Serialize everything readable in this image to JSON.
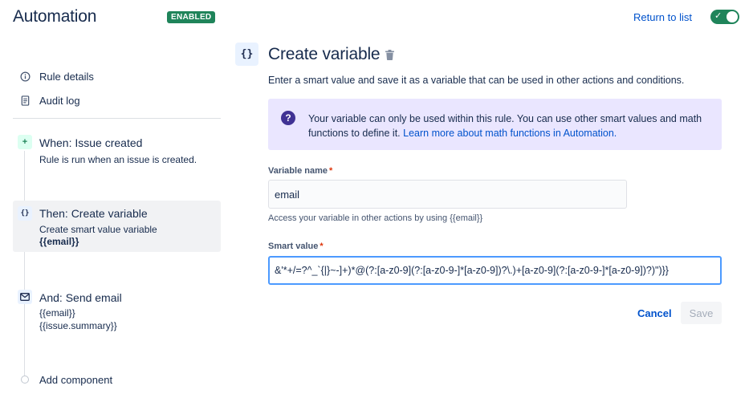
{
  "header": {
    "title": "Automation",
    "status": "ENABLED",
    "return_link": "Return to list",
    "toggle_on": true
  },
  "sidebar": {
    "rule_details": "Rule details",
    "audit_log": "Audit log",
    "components": [
      {
        "icon": "plus-icon",
        "title": "When: Issue created",
        "subtitle": "Rule is run when an issue is created."
      },
      {
        "icon": "braces-icon",
        "title": "Then: Create variable",
        "subtitle": "Create smart value variable",
        "subtitle_bold": "{{email}}",
        "selected": true
      },
      {
        "icon": "mail-icon",
        "title": "And: Send email",
        "line1": "{{email}}",
        "line2": "{{issue.summary}}"
      }
    ],
    "add_component": "Add component"
  },
  "main": {
    "icon_glyph": "{}",
    "title": "Create variable",
    "description": "Enter a smart value and save it as a variable that can be used in other actions and conditions.",
    "info": {
      "text": "Your variable can only be used within this rule. You can use other smart values and math functions to define it.",
      "link": "Learn more about math functions in Automation."
    },
    "variable_name": {
      "label": "Variable name",
      "value": "email",
      "help": "Access your variable in other actions by using {{email}}"
    },
    "smart_value": {
      "label": "Smart value",
      "value": "&'*+/=?^_`{|}~-]+)*@(?:[a-z0-9](?:[a-z0-9-]*[a-z0-9])?\\.)+[a-z0-9](?:[a-z0-9-]*[a-z0-9])?)\")}}"
    },
    "cancel_label": "Cancel",
    "save_label": "Save"
  },
  "colors": {
    "accent": "#0052cc",
    "enabled": "#1f845a",
    "info_bg": "#eae6ff",
    "info_icon": "#403294"
  }
}
